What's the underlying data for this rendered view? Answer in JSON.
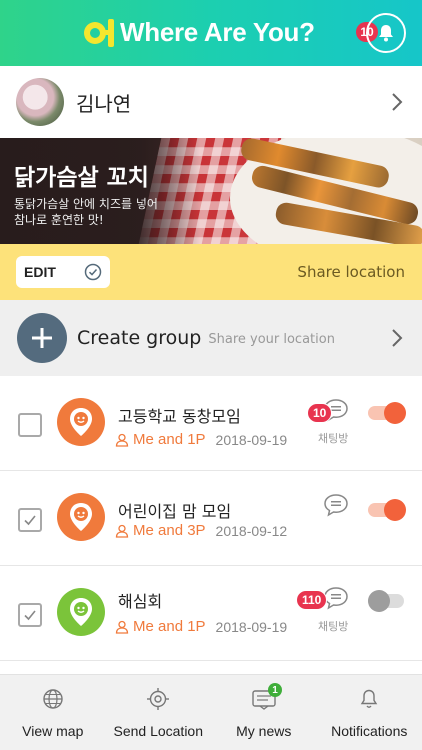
{
  "colors": {
    "header_gradient_start": "#2fd38a",
    "header_gradient_end": "#16c6c9",
    "accent_orange": "#f07a3c",
    "badge_red": "#e8344f",
    "action_bar_yellow": "#fde27a",
    "create_button": "#546b7e",
    "group_green": "#7bc43a"
  },
  "header": {
    "logo_glyph": "어",
    "app_title": "Where Are You?",
    "notification_count": "10",
    "bell_icon": "bell-icon"
  },
  "profile": {
    "name": "김나연"
  },
  "banner": {
    "title": "닭가슴살 꼬치",
    "subtitle_line1": "통닭가슴살 안에 치즈를 넣어",
    "subtitle_line2": "참나로 훈연한 맛!"
  },
  "action_bar": {
    "edit_label": "EDIT",
    "share_label": "Share location"
  },
  "create_group": {
    "title": "Create group",
    "subtitle": "Share your location"
  },
  "groups": [
    {
      "name": "고등학교 동창모임",
      "members": "Me and 1P",
      "date": "2018-09-19",
      "chat_badge": "10",
      "chat_label": "채팅방",
      "checked": false,
      "toggle_on": true,
      "icon_color": "#f07a3c"
    },
    {
      "name": "어린이집 맘 모임",
      "members": "Me and 3P",
      "date": "2018-09-12",
      "chat_badge": "",
      "chat_label": "",
      "checked": true,
      "toggle_on": true,
      "icon_color": "#f07a3c"
    },
    {
      "name": "해심회",
      "members": "Me and 1P",
      "date": "2018-09-19",
      "chat_badge": "110",
      "chat_label": "채팅방",
      "checked": true,
      "toggle_on": false,
      "icon_color": "#7bc43a"
    }
  ],
  "tabbar": {
    "tabs": [
      {
        "label": "View map",
        "icon": "globe-icon"
      },
      {
        "label": "Send Location",
        "icon": "crosshair-icon"
      },
      {
        "label": "My news",
        "icon": "news-icon",
        "badge": "1"
      },
      {
        "label": "Notifications",
        "icon": "bell-icon"
      }
    ]
  }
}
